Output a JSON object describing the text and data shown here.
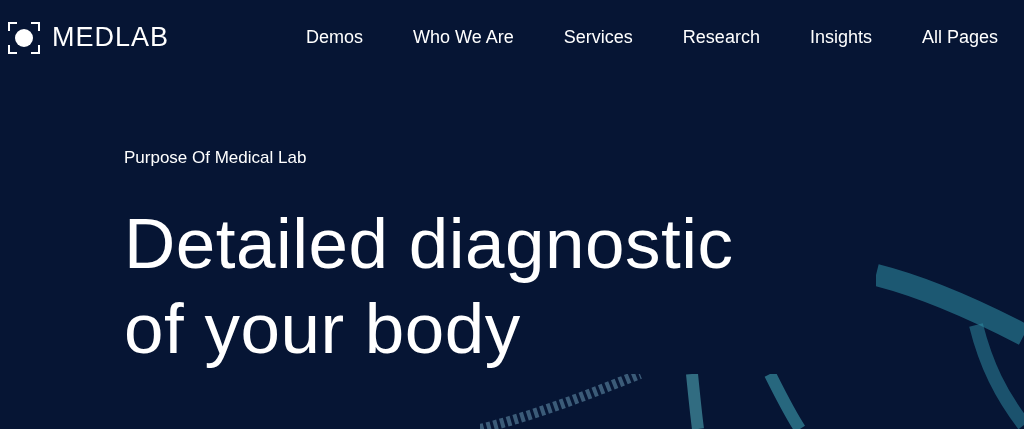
{
  "logo": {
    "text": "MEDLAB"
  },
  "nav": [
    {
      "label": "Demos"
    },
    {
      "label": "Who We Are"
    },
    {
      "label": "Services"
    },
    {
      "label": "Research"
    },
    {
      "label": "Insights"
    },
    {
      "label": "All Pages"
    }
  ],
  "hero": {
    "eyebrow": "Purpose Of Medical Lab",
    "title_lines": [
      "Detailed diagnostic",
      "of your body"
    ]
  }
}
